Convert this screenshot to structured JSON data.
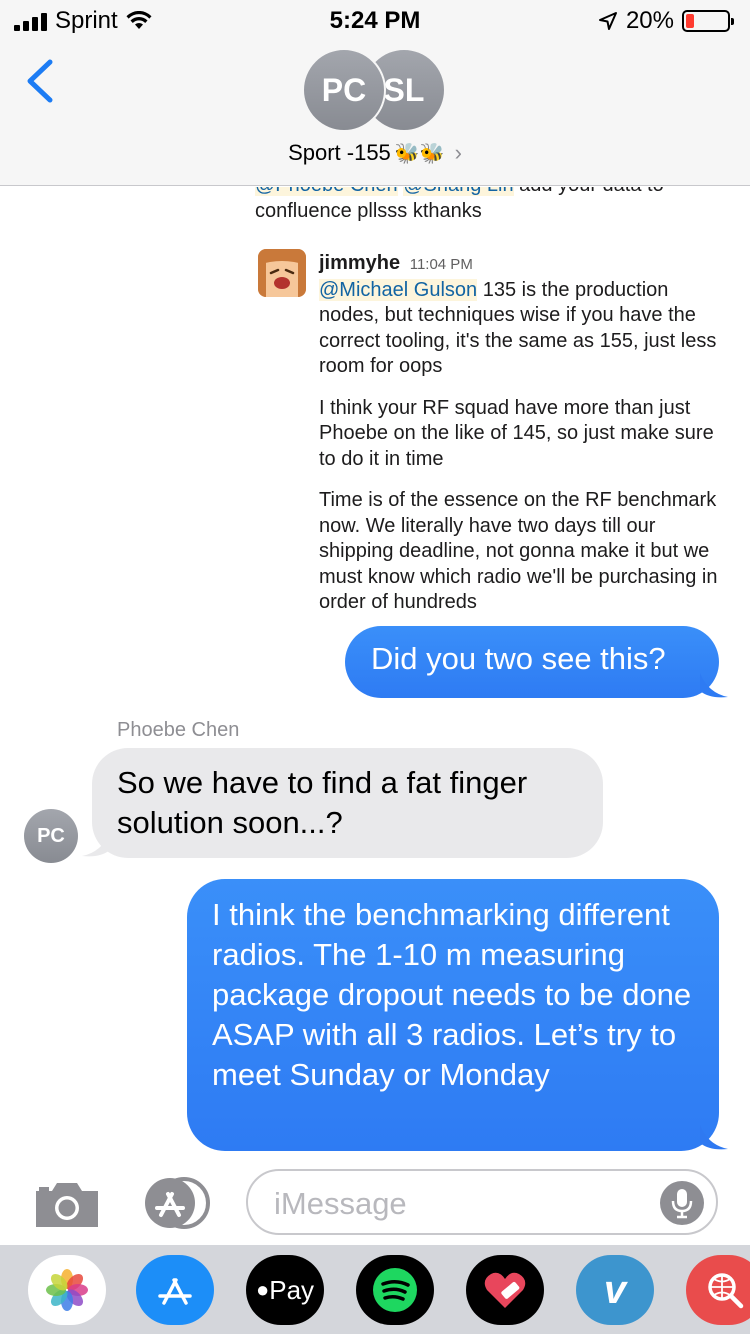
{
  "status_bar": {
    "carrier": "Sprint",
    "time": "5:24 PM",
    "battery": "20%",
    "battery_level": 0.2,
    "battery_color": "#ff3b30"
  },
  "header": {
    "participants": [
      "PC",
      "SL"
    ],
    "title": "Sport -155",
    "title_emoji": "🐝🐝"
  },
  "embedded_screenshot": {
    "top_text": "@Phoebe Chen @Shang Lin add your data to confluence pllsss kthanks",
    "top_mentions": [
      "@Phoebe Chen",
      "@Shang Lin"
    ],
    "top_rest": "add your data to confluence pllsss kthanks",
    "author": "jimmyhe",
    "timestamp": "11:04 PM",
    "mention": "@Michael Gulson",
    "paragraph1": "135 is the production nodes, but techniques wise if you have the correct tooling, it's the same as 155, just less room for oops",
    "paragraph2": "I think your RF squad have more than just Phoebe on the like of 145, so just make sure to do it in time",
    "paragraph3": "Time is of the essence on the RF benchmark now. We literally have two days till our shipping deadline, not gonna make it but we must know which radio we'll be purchasing in order of hundreds"
  },
  "messages": [
    {
      "direction": "outgoing",
      "text": "Did you two see this?"
    },
    {
      "direction": "incoming",
      "sender": "Phoebe Chen",
      "sender_initials": "PC",
      "text": "So we have to find a fat finger solution soon...?"
    },
    {
      "direction": "outgoing",
      "text": "I think the benchmarking different radios.  The 1-10 m measuring package dropout needs to be done ASAP with all 3 radios.  Let’s try to meet Sunday or Monday"
    }
  ],
  "input_bar": {
    "placeholder": "iMessage",
    "icons": [
      "camera-icon",
      "app-store-icon",
      "microphone-icon"
    ]
  },
  "app_drawer": {
    "apps": [
      "Photos",
      "App Store",
      "Pay",
      "Spotify",
      "Heart",
      "Venmo",
      "Search"
    ],
    "pay_label": "Pay",
    "venmo_label": "v"
  },
  "colors": {
    "outgoing_bubble": "#2e7bf3",
    "incoming_bubble": "#e9e9eb",
    "ios_blue": "#1c7cf4"
  }
}
